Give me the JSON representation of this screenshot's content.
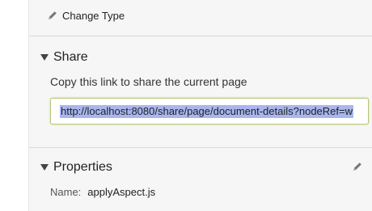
{
  "actions": {
    "change_type_label": "Change Type"
  },
  "share": {
    "title": "Share",
    "caption": "Copy this link to share the current page",
    "link": "http://localhost:8080/share/page/document-details?nodeRef=w"
  },
  "properties": {
    "title": "Properties",
    "name_label": "Name:",
    "name_value": "applyAspect.js"
  },
  "icons": {
    "change_type": "pencil-icon",
    "edit_properties": "pencil-icon",
    "section_toggle": "triangle-down-icon"
  }
}
